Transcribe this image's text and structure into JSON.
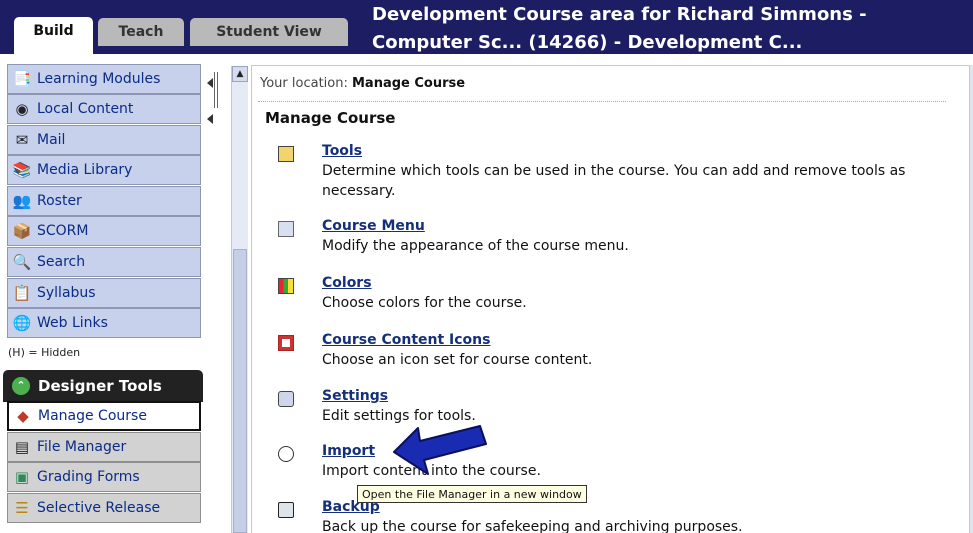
{
  "tabs": {
    "build": "Build",
    "teach": "Teach",
    "student_view": "Student View"
  },
  "header": {
    "title_line1": "Development Course area for Richard Simmons -",
    "title_line2": "Computer Sc... (14266) - Development C..."
  },
  "sidebar": {
    "items": [
      {
        "label": "Learning Modules",
        "icon": "learning-modules-icon"
      },
      {
        "label": "Local Content",
        "icon": "local-content-icon"
      },
      {
        "label": "Mail",
        "icon": "mail-icon"
      },
      {
        "label": "Media Library",
        "icon": "media-library-icon"
      },
      {
        "label": "Roster",
        "icon": "roster-icon"
      },
      {
        "label": "SCORM",
        "icon": "scorm-icon"
      },
      {
        "label": "Search",
        "icon": "search-icon"
      },
      {
        "label": "Syllabus",
        "icon": "syllabus-icon"
      },
      {
        "label": "Web Links",
        "icon": "web-links-icon"
      }
    ],
    "hidden_note": "(H) = Hidden",
    "designer_tools": "Designer Tools",
    "designer_items": [
      {
        "label": "Manage Course",
        "icon": "manage-course-icon",
        "active": true
      },
      {
        "label": "File Manager",
        "icon": "file-manager-icon"
      },
      {
        "label": "Grading Forms",
        "icon": "grading-forms-icon"
      },
      {
        "label": "Selective Release",
        "icon": "selective-release-icon"
      }
    ]
  },
  "main": {
    "location_prefix": "Your location:",
    "location_value": "Manage Course",
    "page_title": "Manage Course",
    "entries": [
      {
        "title": "Tools",
        "desc": "Determine which tools can be used in the course. You can add and remove tools as necessary.",
        "icon": "tools-icon"
      },
      {
        "title": "Course Menu",
        "desc": "Modify the appearance of the course menu.",
        "icon": "course-menu-icon"
      },
      {
        "title": "Colors",
        "desc": "Choose colors for the course.",
        "icon": "colors-icon"
      },
      {
        "title": "Course Content Icons",
        "desc": "Choose an icon set for course content.",
        "icon": "content-icons-icon"
      },
      {
        "title": "Settings",
        "desc": "Edit settings for tools.",
        "icon": "settings-icon"
      },
      {
        "title": "Import",
        "desc": "Import content into the course.",
        "icon": "import-icon"
      },
      {
        "title": "Backup",
        "desc": "Back up the course for safekeeping and archiving purposes.",
        "icon": "backup-icon"
      }
    ],
    "tooltip": "Open the File Manager in a new window"
  },
  "colors": {
    "header_bg": "#1d1d64",
    "sidebar_item": "#c7d1ec",
    "link": "#15307b",
    "arrow": "#1a2bb3"
  }
}
